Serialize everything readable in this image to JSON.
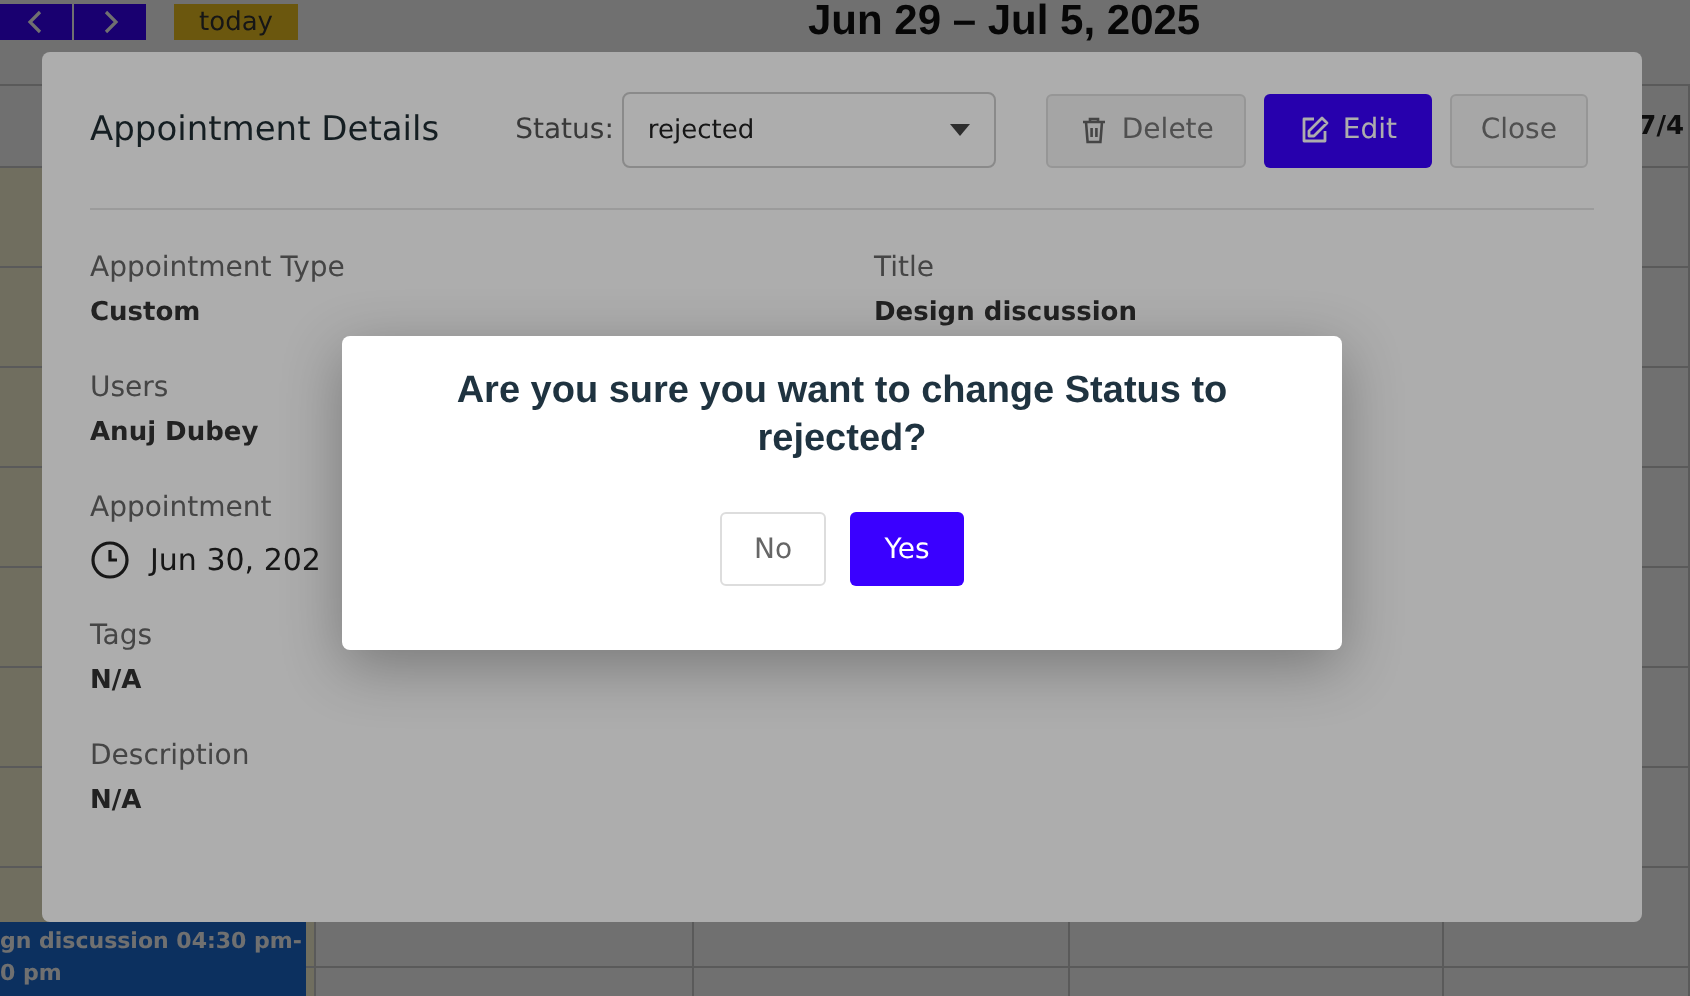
{
  "calendar": {
    "today_button": "today",
    "range_title": "Jun 29 – Jul 5, 2025",
    "day_label": "7/4",
    "event": {
      "lines": [
        "gn discussion 04:30 pm-",
        "0 pm"
      ]
    }
  },
  "details": {
    "title": "Appointment Details",
    "status": {
      "label": "Status:",
      "value": "rejected"
    },
    "buttons": [
      {
        "label": "Delete",
        "kind": "delete"
      },
      {
        "label": "Edit",
        "kind": "edit"
      },
      {
        "label": "Close",
        "kind": "close"
      }
    ],
    "left_fields": [
      {
        "label": "Appointment Type",
        "value": "Custom",
        "kind": "text"
      },
      {
        "label": "Users",
        "value": "Anuj Dubey",
        "kind": "text"
      },
      {
        "label": "Appointment",
        "value": "Jun 30, 202",
        "kind": "datetime"
      },
      {
        "label": "Tags",
        "value": "N/A",
        "kind": "text"
      },
      {
        "label": "Description",
        "value": "N/A",
        "kind": "text"
      }
    ],
    "right_fields": [
      {
        "label": "Title",
        "value": "Design discussion",
        "kind": "text"
      }
    ]
  },
  "confirm": {
    "message": "Are you sure you want to change Status to rejected?",
    "buttons": [
      {
        "label": "No",
        "kind": "secondary"
      },
      {
        "label": "Yes",
        "kind": "primary"
      }
    ]
  }
}
